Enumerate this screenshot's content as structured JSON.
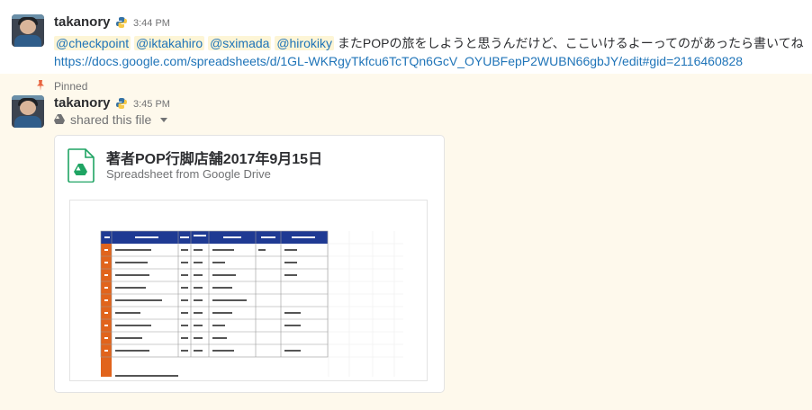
{
  "message1": {
    "author": "takanory",
    "time": "3:44 PM",
    "mentions": [
      "@checkpoint",
      "@iktakahiro",
      "@sximada",
      "@hirokiky"
    ],
    "text": "またPOPの旅をしようと思うんだけど、ここいけるよーってのがあったら書いてね",
    "link": "https://docs.google.com/spreadsheets/d/1GL-WKRgyTkfcu6TcTQn6GcV_OYUBFepP2WUBN66gbJY/edit#gid=2116460828"
  },
  "message2": {
    "pinned_label": "Pinned",
    "author": "takanory",
    "time": "3:45 PM",
    "shared_text": "shared this file"
  },
  "file": {
    "title": "著者POP行脚店舗2017年9月15日",
    "subtitle": "Spreadsheet from Google Drive"
  },
  "colors": {
    "link": "#1f74b8",
    "pinned_bg": "#fef9ec",
    "drive_green": "#1fa463",
    "sheet_header": "#1f3a93",
    "sheet_number_col": "#e1641c"
  }
}
